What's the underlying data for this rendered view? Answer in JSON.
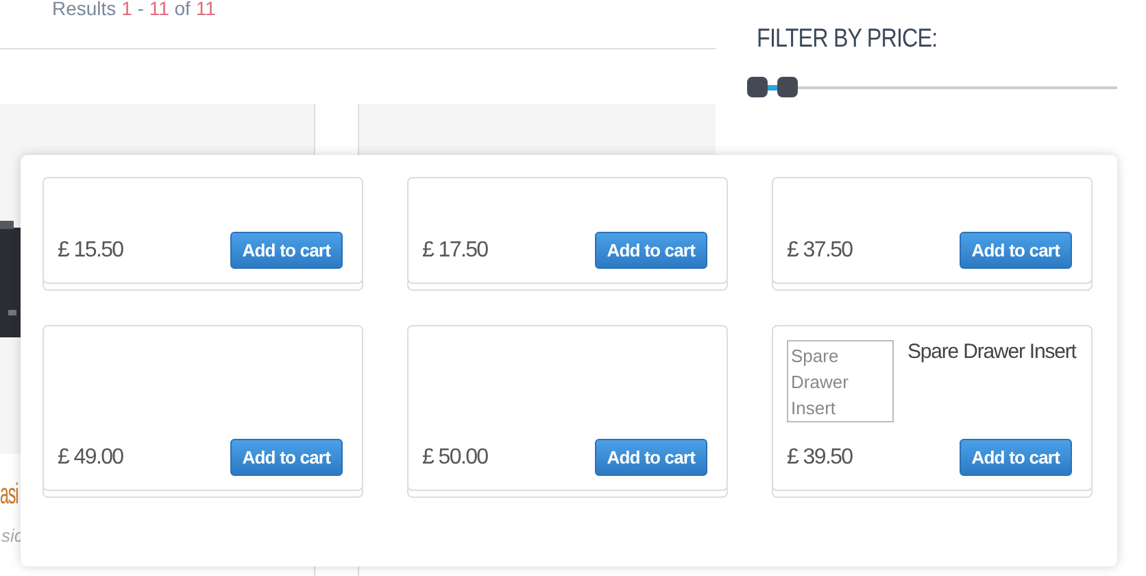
{
  "results": {
    "label": "Results",
    "from": "1",
    "separator": "-",
    "to": "11",
    "of": "of",
    "total": "11"
  },
  "filter": {
    "title": "FILTER BY PRICE:"
  },
  "background_products": [
    {
      "name": "asi",
      "subtitle": "sic",
      "kind": "picture"
    },
    {
      "kind": "blank"
    }
  ],
  "products": [
    {
      "kind": "plain",
      "price": "£ 15.50",
      "button": "Add to cart"
    },
    {
      "kind": "plain",
      "price": "£ 17.50",
      "button": "Add to cart"
    },
    {
      "kind": "plain",
      "price": "£ 37.50",
      "button": "Add to cart"
    },
    {
      "kind": "plain",
      "price": "£ 49.00",
      "button": "Add to cart"
    },
    {
      "kind": "plain",
      "price": "£ 50.00",
      "button": "Add to cart"
    },
    {
      "kind": "with_image",
      "image_alt": "Spare Drawer Insert",
      "name": "Spare Drawer Insert",
      "price": "£ 39.50",
      "button": "Add to cart"
    }
  ]
}
